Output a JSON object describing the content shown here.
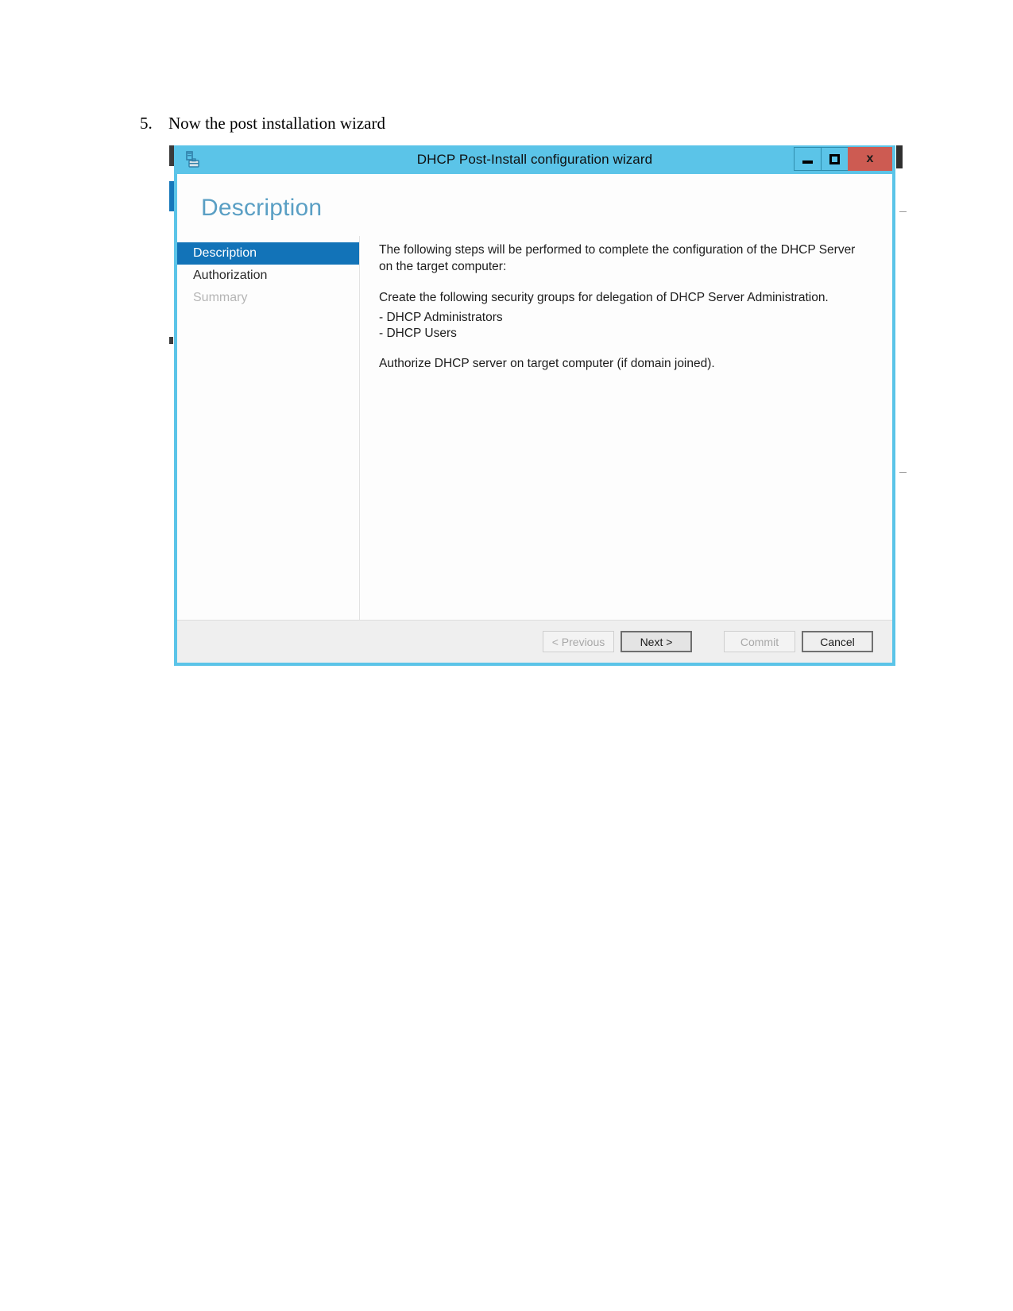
{
  "document": {
    "list_number": "5.",
    "list_text": "Now the post installation wizard"
  },
  "window": {
    "title": "DHCP Post-Install configuration wizard",
    "icon": "dhcp-wizard-icon",
    "accent_color": "#5bc4e8",
    "close_color": "#cd5b52",
    "controls": {
      "minimize": "minimize-icon",
      "maximize": "maximize-icon",
      "close_label": "x"
    }
  },
  "page": {
    "header": "Description"
  },
  "nav": {
    "steps": [
      {
        "label": "Description",
        "state": "current"
      },
      {
        "label": "Authorization",
        "state": "enabled"
      },
      {
        "label": "Summary",
        "state": "disabled"
      }
    ]
  },
  "content": {
    "intro": "The following steps will be performed to complete the configuration of the DHCP Server on the target computer:",
    "groups_intro": "Create the following security groups for delegation of DHCP Server Administration.",
    "group_items": [
      "- DHCP Administrators",
      "- DHCP Users"
    ],
    "authorize_note": "Authorize DHCP server on target computer (if domain joined)."
  },
  "footer": {
    "buttons": [
      {
        "label": "< Previous",
        "state": "disabled"
      },
      {
        "label": "Next >",
        "state": "default"
      },
      {
        "label": "Commit",
        "state": "disabled"
      },
      {
        "label": "Cancel",
        "state": "strong"
      }
    ]
  }
}
